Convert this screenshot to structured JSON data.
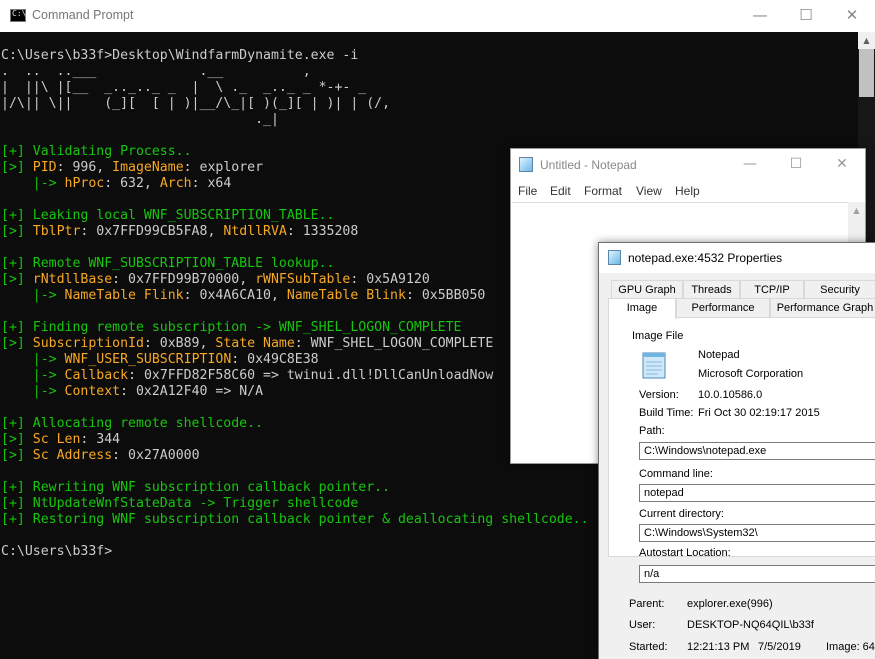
{
  "cmd": {
    "title": "Command Prompt",
    "controls": {
      "minimize": "—",
      "maximize": "☐",
      "close": "✕"
    },
    "lines": [
      [
        [
          "w",
          "C:\\Users\\b33f>Desktop\\WindfarmDynamite.exe -i"
        ]
      ],
      [
        [
          "w",
          ".  ..  ..___             .__          ,"
        ]
      ],
      [
        [
          "w",
          "|  ||\\ |[__  _.._.._ _  |  \\ ._  _.._ _ *-+- _"
        ]
      ],
      [
        [
          "w",
          "|/\\|| \\||    (_][  [ | )|__/\\_|[ )(_][ | )| | (/,"
        ]
      ],
      [
        [
          "w",
          "                                ._|"
        ]
      ],
      [
        [
          "w",
          ""
        ]
      ],
      [
        [
          "g",
          "[+] Validating Process.."
        ]
      ],
      [
        [
          "g",
          "[>] "
        ],
        [
          "o",
          "PID"
        ],
        [
          "w",
          ": 996, "
        ],
        [
          "o",
          "ImageName"
        ],
        [
          "w",
          ": explorer"
        ]
      ],
      [
        [
          "g",
          "    |-> "
        ],
        [
          "o",
          "hProc"
        ],
        [
          "w",
          ": 632, "
        ],
        [
          "o",
          "Arch"
        ],
        [
          "w",
          ": x64"
        ]
      ],
      [
        [
          "w",
          ""
        ]
      ],
      [
        [
          "g",
          "[+] Leaking local WNF_SUBSCRIPTION_TABLE.."
        ]
      ],
      [
        [
          "g",
          "[>] "
        ],
        [
          "o",
          "TblPtr"
        ],
        [
          "w",
          ": 0x7FFD99CB5FA8, "
        ],
        [
          "o",
          "NtdllRVA"
        ],
        [
          "w",
          ": 1335208"
        ]
      ],
      [
        [
          "w",
          ""
        ]
      ],
      [
        [
          "g",
          "[+] Remote WNF_SUBSCRIPTION_TABLE lookup.."
        ]
      ],
      [
        [
          "g",
          "[>] "
        ],
        [
          "o",
          "rNtdllBase"
        ],
        [
          "w",
          ": 0x7FFD99B70000, "
        ],
        [
          "o",
          "rWNFSubTable"
        ],
        [
          "w",
          ": 0x5A9120"
        ]
      ],
      [
        [
          "g",
          "    |-> "
        ],
        [
          "o",
          "NameTable Flink"
        ],
        [
          "w",
          ": 0x4A6CA10, "
        ],
        [
          "o",
          "NameTable Blink"
        ],
        [
          "w",
          ": 0x5BB050"
        ]
      ],
      [
        [
          "w",
          ""
        ]
      ],
      [
        [
          "g",
          "[+] Finding remote subscription -> WNF_SHEL_LOGON_COMPLETE"
        ]
      ],
      [
        [
          "g",
          "[>] "
        ],
        [
          "o",
          "SubscriptionId"
        ],
        [
          "w",
          ": 0xB89, "
        ],
        [
          "o",
          "State Name"
        ],
        [
          "w",
          ": WNF_SHEL_LOGON_COMPLETE"
        ]
      ],
      [
        [
          "g",
          "    |-> "
        ],
        [
          "o",
          "WNF_USER_SUBSCRIPTION"
        ],
        [
          "w",
          ": 0x49C8E38"
        ]
      ],
      [
        [
          "g",
          "    |-> "
        ],
        [
          "o",
          "Callback"
        ],
        [
          "w",
          ": 0x7FFD82F58C60 => twinui.dll!DllCanUnloadNow"
        ]
      ],
      [
        [
          "g",
          "    |-> "
        ],
        [
          "o",
          "Context"
        ],
        [
          "w",
          ": 0x2A12F40 => N/A"
        ]
      ],
      [
        [
          "w",
          ""
        ]
      ],
      [
        [
          "g",
          "[+] Allocating remote shellcode.."
        ]
      ],
      [
        [
          "g",
          "[>] "
        ],
        [
          "o",
          "Sc Len"
        ],
        [
          "w",
          ": 344"
        ]
      ],
      [
        [
          "g",
          "[>] "
        ],
        [
          "o",
          "Sc Address"
        ],
        [
          "w",
          ": 0x27A0000"
        ]
      ],
      [
        [
          "w",
          ""
        ]
      ],
      [
        [
          "g",
          "[+] Rewriting WNF subscription callback pointer.."
        ]
      ],
      [
        [
          "g",
          "[+] NtUpdateWnfStateData -> Trigger shellcode"
        ]
      ],
      [
        [
          "g",
          "[+] Restoring WNF subscription callback pointer & deallocating shellcode.."
        ]
      ],
      [
        [
          "w",
          ""
        ]
      ],
      [
        [
          "w",
          "C:\\Users\\b33f>"
        ]
      ]
    ]
  },
  "notepad": {
    "title": "Untitled - Notepad",
    "controls": {
      "minimize": "—",
      "maximize": "☐",
      "close": "✕"
    },
    "menu": [
      "File",
      "Edit",
      "Format",
      "View",
      "Help"
    ]
  },
  "props": {
    "title": "notepad.exe:4532 Properties",
    "tabs_row1": [
      "GPU Graph",
      "Threads",
      "TCP/IP",
      "Security"
    ],
    "tabs_row2": [
      "Image",
      "Performance",
      "Performance Graph"
    ],
    "group_title": "Image File",
    "file_name": "Notepad",
    "company": "Microsoft Corporation",
    "version_label": "Version:",
    "version": "10.0.10586.0",
    "build_label": "Build Time:",
    "build_time": "Fri Oct 30 02:19:17 2015",
    "path_label": "Path:",
    "path": "C:\\Windows\\notepad.exe",
    "cmdline_label": "Command line:",
    "cmdline": "notepad",
    "curdir_label": "Current directory:",
    "curdir": "C:\\Windows\\System32\\",
    "autostart_label": "Autostart Location:",
    "autostart": "n/a",
    "parent_label": "Parent:",
    "parent": "explorer.exe(996)",
    "user_label": "User:",
    "user": "DESKTOP-NQ64QIL\\b33f",
    "started_label": "Started:",
    "started_time": "12:21:13 PM",
    "started_date": "7/5/2019",
    "image_label": "Image: 64"
  }
}
